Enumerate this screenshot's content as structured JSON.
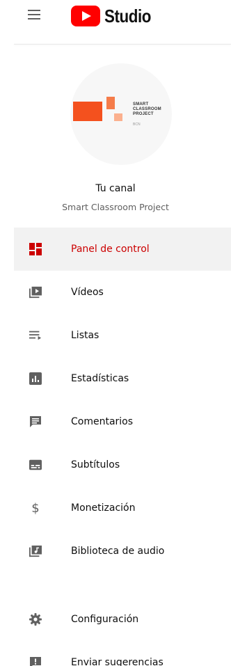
{
  "header": {
    "menu_icon": "hamburger-menu-icon",
    "logo_text": "Studio",
    "logo_color": "#ff0000"
  },
  "channel": {
    "title": "Tu canal",
    "name": "Smart Classroom Project",
    "avatar": {
      "brand_lines": [
        "SMART",
        "CLASSROOM",
        "PROJECT"
      ],
      "brand_sub": "BCN"
    }
  },
  "nav": {
    "items": [
      {
        "label": "Panel de control",
        "icon": "dashboard-icon",
        "active": true
      },
      {
        "label": "Vídeos",
        "icon": "video-library-icon",
        "active": false
      },
      {
        "label": "Listas",
        "icon": "playlist-icon",
        "active": false
      },
      {
        "label": "Estadísticas",
        "icon": "analytics-icon",
        "active": false
      },
      {
        "label": "Comentarios",
        "icon": "comment-icon",
        "active": false
      },
      {
        "label": "Subtítulos",
        "icon": "subtitles-icon",
        "active": false
      },
      {
        "label": "Monetización",
        "icon": "dollar-icon",
        "active": false
      },
      {
        "label": "Biblioteca de audio",
        "icon": "audio-library-icon",
        "active": false
      }
    ],
    "bottom_items": [
      {
        "label": "Configuración",
        "icon": "gear-icon"
      },
      {
        "label": "Enviar sugerencias",
        "icon": "feedback-icon"
      }
    ]
  },
  "colors": {
    "accent": "#cc0000",
    "icon_gray": "#606060",
    "active_bg": "#f2f2f2"
  }
}
